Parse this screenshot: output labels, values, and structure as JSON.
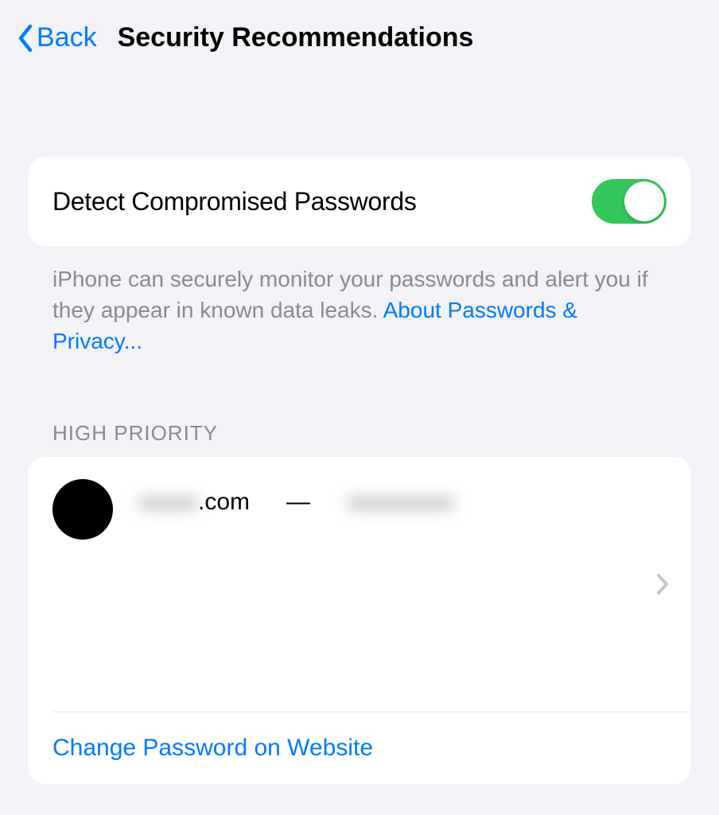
{
  "nav": {
    "back_label": "Back",
    "title": "Security Recommendations"
  },
  "detect": {
    "label": "Detect Compromised Passwords",
    "enabled": true,
    "description_text": "iPhone can securely monitor your passwords and alert you if they appear in known data leaks. ",
    "link_text": "About Passwords & Privacy..."
  },
  "section": {
    "header": "HIGH PRIORITY"
  },
  "entry": {
    "domain_prefix_blurred": "xxxxx",
    "domain_suffix": ".com",
    "separator": "—",
    "account_blurred": "xxxxxxxxx"
  },
  "action": {
    "change_password_label": "Change Password on Website"
  }
}
